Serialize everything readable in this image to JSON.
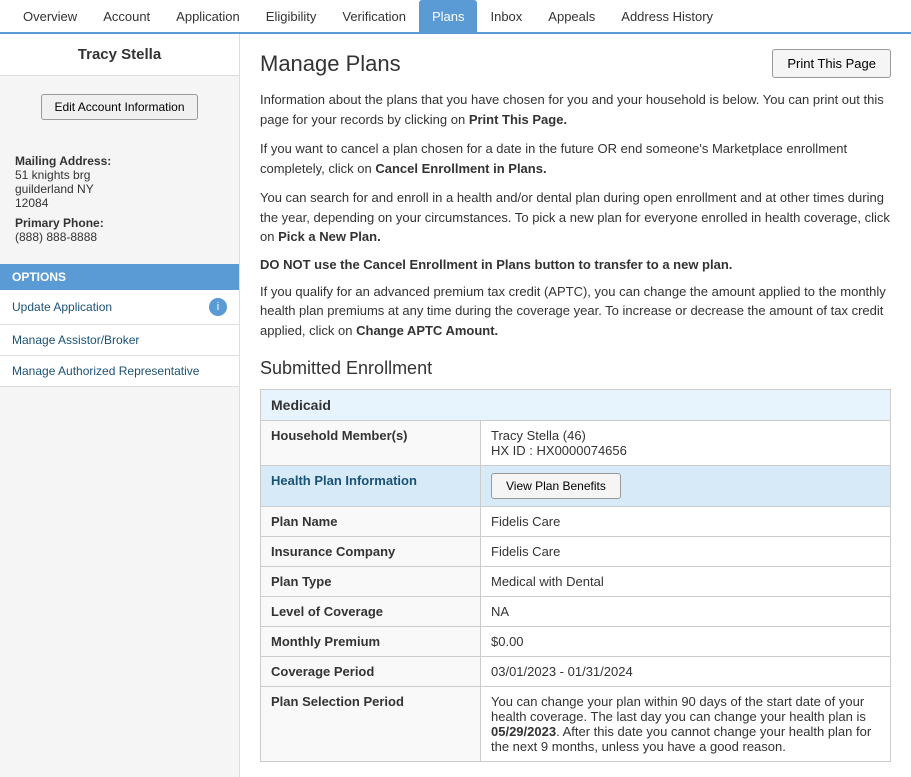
{
  "user": {
    "name": "Tracy Stella"
  },
  "sidebar": {
    "edit_btn": "Edit Account Information",
    "mailing_label": "Mailing Address:",
    "address_line1": "51 knights brg",
    "address_line2": "guilderland NY",
    "address_line3": "12084",
    "phone_label": "Primary Phone:",
    "phone": "(888) 888-8888",
    "options_header": "OPTIONS",
    "options": [
      {
        "label": "Update Application",
        "has_icon": true
      },
      {
        "label": "Manage Assistor/Broker",
        "has_icon": false
      },
      {
        "label": "Manage Authorized Representative",
        "has_icon": false
      }
    ]
  },
  "nav": {
    "tabs": [
      {
        "label": "Overview",
        "active": false
      },
      {
        "label": "Account",
        "active": false
      },
      {
        "label": "Application",
        "active": false
      },
      {
        "label": "Eligibility",
        "active": false
      },
      {
        "label": "Verification",
        "active": false
      },
      {
        "label": "Plans",
        "active": true
      },
      {
        "label": "Inbox",
        "active": false
      },
      {
        "label": "Appeals",
        "active": false
      },
      {
        "label": "Address History",
        "active": false
      }
    ]
  },
  "content": {
    "page_title": "Manage Plans",
    "print_btn": "Print This Page",
    "para1": "Information about the plans that you have chosen for you and your household is below. You can print out this page for your records by clicking on ",
    "para1_bold": "Print This Page.",
    "para2_start": "If you want to cancel a plan chosen for a date in the future OR end someone's Marketplace enrollment completely, click on ",
    "para2_bold": "Cancel Enrollment in Plans.",
    "para3_start": "You can search for and enroll in a health and/or dental plan during open enrollment and at other times during the year, depending on your circumstances. To pick a new plan for everyone enrolled in health coverage, click on ",
    "para3_bold": "Pick a New Plan.",
    "warning": "DO NOT use the Cancel Enrollment in Plans button to transfer to a new plan.",
    "para4_start": "If you qualify for an advanced premium tax credit (APTC), you can change the amount applied to the monthly health plan premiums at any time during the coverage year. To increase or decrease the amount of tax credit applied, click on ",
    "para4_bold": "Change APTC Amount.",
    "section_title": "Submitted Enrollment",
    "table": {
      "header": "Medicaid",
      "rows": [
        {
          "label": "Household Member(s)",
          "value": "Tracy Stella (46)\nHX ID : HX0000074656",
          "multi": true,
          "value1": "Tracy Stella (46)",
          "value2": "HX ID : HX0000074656"
        },
        {
          "label": "Health Plan Information",
          "value": "",
          "is_health_plan": true,
          "btn": "View Plan Benefits"
        },
        {
          "label": "Plan Name",
          "value": "Fidelis Care"
        },
        {
          "label": "Insurance Company",
          "value": "Fidelis Care"
        },
        {
          "label": "Plan Type",
          "value": "Medical with Dental"
        },
        {
          "label": "Level of Coverage",
          "value": "NA"
        },
        {
          "label": "Monthly Premium",
          "value": "$0.00"
        },
        {
          "label": "Coverage Period",
          "value": "03/01/2023 - 01/31/2024"
        },
        {
          "label": "Plan Selection Period",
          "value": "You can change your plan within 90 days of the start date of your health coverage. The last day you can change your health plan is 05/29/2023. After this date you cannot change your health plan for the next 9 months, unless you have a good reason."
        }
      ]
    }
  }
}
